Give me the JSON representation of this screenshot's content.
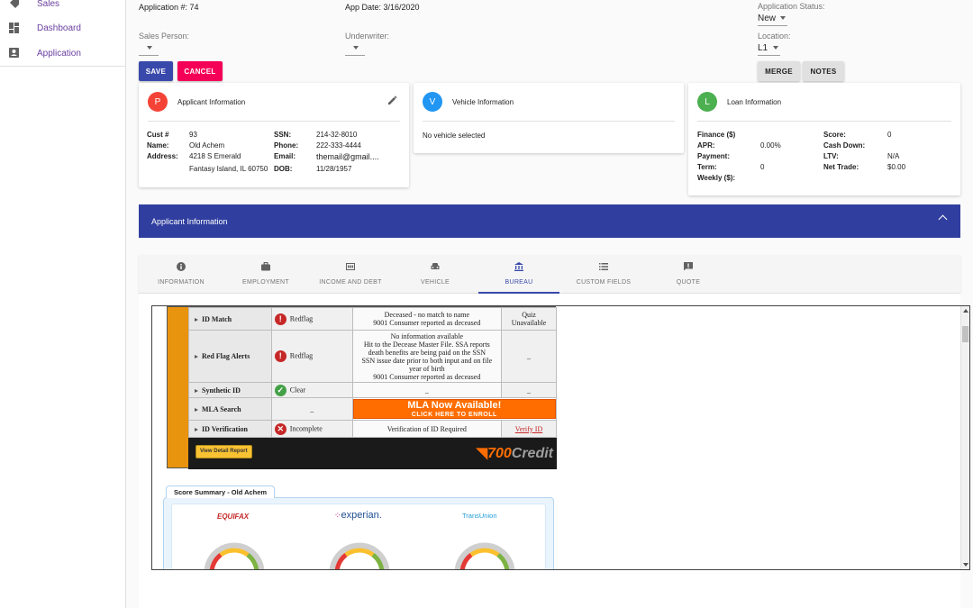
{
  "sidebar": {
    "items": [
      {
        "label": "Sales",
        "icon": "tag-icon"
      },
      {
        "label": "Dashboard",
        "icon": "dashboard-icon"
      },
      {
        "label": "Application",
        "icon": "account-box-icon"
      }
    ]
  },
  "header": {
    "application_no": "Application #: 74",
    "app_date": "App Date: 3/16/2020",
    "sales_person_label": "Sales Person:",
    "sales_person_value": "",
    "underwriter_label": "Underwriter:",
    "underwriter_value": "",
    "status_label": "Application Status:",
    "status_value": "New",
    "location_label": "Location:",
    "location_value": "L1"
  },
  "actions": {
    "save": "SAVE",
    "cancel": "CANCEL",
    "merge": "MERGE",
    "notes": "NOTES"
  },
  "applicant_card": {
    "avatar": "P",
    "avatar_color": "#f44336",
    "title": "Applicant Information",
    "fields": {
      "cust_label": "Cust #",
      "cust": "93",
      "name_label": "Name:",
      "name": "Old Achem",
      "address_label": "Address:",
      "address1": "4218 S Emerald",
      "address2": "Fantasy Island, IL 60750",
      "ssn_label": "SSN:",
      "ssn": "214-32-8010",
      "phone_label": "Phone:",
      "phone": "222-333-4444",
      "email_label": "Email:",
      "email": "themail@gmail....",
      "dob_label": "DOB:",
      "dob": "11/28/1957"
    }
  },
  "vehicle_card": {
    "avatar": "V",
    "avatar_color": "#2196f3",
    "title": "Vehicle Information",
    "empty_text": "No vehicle selected"
  },
  "loan_card": {
    "avatar": "L",
    "avatar_color": "#4caf50",
    "title": "Loan Information",
    "fields": {
      "finance_label": "Finance ($)",
      "finance": "",
      "apr_label": "APR:",
      "apr": "0.00%",
      "payment_label": "Payment:",
      "payment": "",
      "term_label": "Term:",
      "term": "0",
      "weekly_label": "Weekly ($):",
      "weekly": "",
      "score_label": "Score:",
      "score": "0",
      "cashdown_label": "Cash Down:",
      "cashdown": "",
      "ltv_label": "LTV:",
      "ltv": "N/A",
      "nettrade_label": "Net Trade:",
      "nettrade": "$0.00"
    }
  },
  "section_banner": {
    "title": "Applicant Information",
    "color": "#303f9f"
  },
  "tabs": [
    {
      "label": "INFORMATION",
      "icon": "info-icon"
    },
    {
      "label": "EMPLOYMENT",
      "icon": "briefcase-icon"
    },
    {
      "label": "INCOME AND DEBT",
      "icon": "money-icon"
    },
    {
      "label": "VEHICLE",
      "icon": "car-icon"
    },
    {
      "label": "BUREAU",
      "icon": "bank-icon",
      "active": true
    },
    {
      "label": "CUSTOM FIELDS",
      "icon": "list-icon"
    },
    {
      "label": "QUOTE",
      "icon": "feedback-icon"
    }
  ],
  "bureau": {
    "rows": [
      {
        "check": "ID Match",
        "status": "Redflag",
        "detail_lines": [
          "Deceased - no match to name",
          "9001 Consumer reported as deceased"
        ],
        "action_lines": [
          "Quiz",
          "Unavailable"
        ]
      },
      {
        "check": "Red Flag Alerts",
        "status": "Redflag",
        "detail_lines": [
          "No information available",
          "Hit to the Decease Master File. SSA reports",
          "death benefits are being paid on the SSN",
          "SSN issue date prior to both input and on file",
          "year of birth",
          "9001 Consumer reported as deceased"
        ],
        "action_lines": [
          "_"
        ]
      },
      {
        "check": "Synthetic ID",
        "status": "Clear",
        "detail_lines": [
          "_"
        ],
        "action_lines": [
          "_"
        ]
      },
      {
        "check": "MLA Search",
        "status": "_",
        "mla_title": "MLA Now Available!",
        "mla_sub": "CLICK HERE TO ENROLL"
      },
      {
        "check": "ID Verification",
        "status": "Incomplete",
        "detail_lines": [
          "Verification of ID Required"
        ],
        "action_link": "Verify ID"
      }
    ],
    "view_report": "View Detail Report",
    "brand_num": "700",
    "brand_text": "Credit"
  },
  "score_summary": {
    "title": "Score Summary - Old Achem",
    "bureaus": [
      "EQUIFAX",
      "experian.",
      "TransUnion"
    ]
  }
}
